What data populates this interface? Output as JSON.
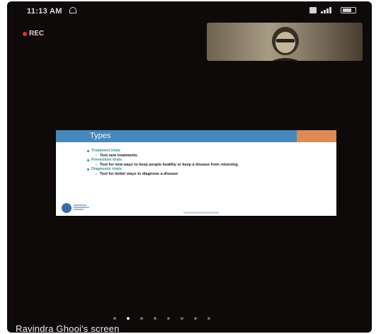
{
  "status_bar": {
    "time": "11:13 AM",
    "notification_icon": "notification-icon",
    "sim_icon": "sim-icon",
    "signal_icon": "signal-icon",
    "battery_icon": "battery-icon"
  },
  "recording": {
    "label": "REC",
    "color": "#d23a3a"
  },
  "slide": {
    "title": "Types",
    "header_color": "#4a88b8",
    "accent_color": "#d98a55",
    "items": [
      {
        "label": "Treatment trials",
        "sub": "Test new treatments"
      },
      {
        "label": "Prevention trials",
        "sub": "Test for new ways to keep people healthy or keep a disease from returning."
      },
      {
        "label": "Diagnostic trials",
        "sub": "Test for better ways to diagnose a disease"
      }
    ]
  },
  "pager": {
    "count": 8,
    "active_index": 1
  },
  "screen_owner": "Ravindra Ghooi's screen"
}
